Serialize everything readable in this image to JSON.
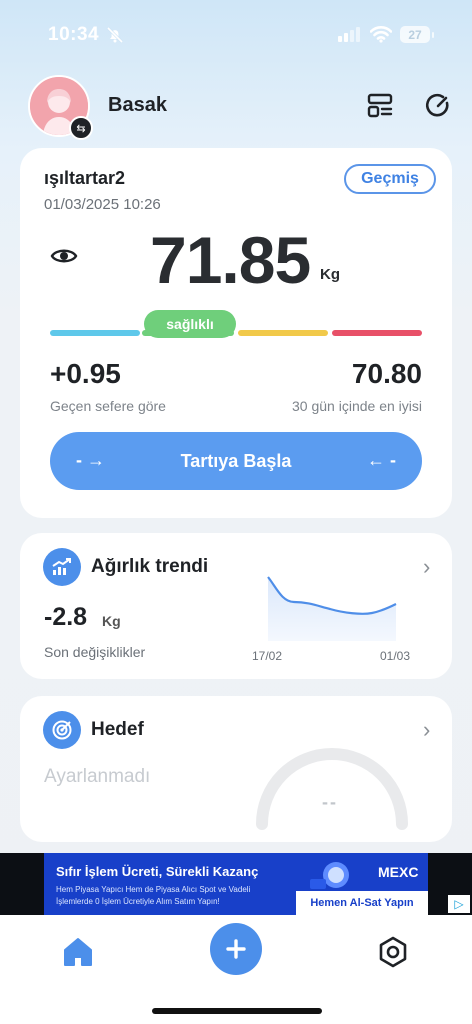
{
  "status_bar": {
    "time": "10:34",
    "battery": "27"
  },
  "header": {
    "username": "Basak"
  },
  "scale_card": {
    "device_name": "ışıltartar2",
    "date": "01/03/2025 10:26",
    "history_label": "Geçmiş",
    "weight": "71.85",
    "unit": "Kg",
    "status": "sağlıklı",
    "bar_colors": [
      "#5ec8ea",
      "#6fcf7b",
      "#f1c94a",
      "#e85068"
    ],
    "delta": "+0.95",
    "delta_label": "Geçen sefere göre",
    "best": "70.80",
    "best_label": "30 gün içinde en iyisi",
    "start_label": "Tartıya Başla"
  },
  "trend_card": {
    "title": "Ağırlık trendi",
    "value": "-2.8",
    "unit": "Kg",
    "label": "Son değişiklikler",
    "x_start": "17/02",
    "x_end": "01/03"
  },
  "goal_card": {
    "title": "Hedef",
    "empty_text": "Ayarlanmadı",
    "gauge_value": "--"
  },
  "ad": {
    "title": "Sıfır İşlem Ücreti, Sürekli Kazanç",
    "line1": "Hem Piyasa Yapıcı Hem de Piyasa Alıcı Spot ve Vadeli",
    "line2": "İşlemlerde 0 İşlem Ücretiyle Alım Satım Yapın!",
    "brand": "MEXC",
    "cta": "Hemen Al-Sat Yapın"
  },
  "accent_color": "#4c8fea"
}
